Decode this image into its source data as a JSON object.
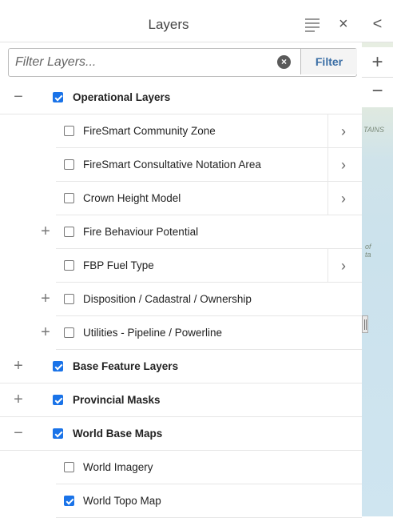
{
  "panel": {
    "title": "Layers",
    "list_icon": "list-icon",
    "close_label": "×"
  },
  "filter": {
    "placeholder": "Filter Layers...",
    "clear_label": "×",
    "button_label": "Filter"
  },
  "layers": [
    {
      "label": "Operational Layers",
      "checked": true,
      "bold": true,
      "expander": "−",
      "level": 0,
      "chevron": false
    },
    {
      "label": "FireSmart Community Zone",
      "checked": false,
      "bold": false,
      "expander": "",
      "level": 1,
      "chevron": true
    },
    {
      "label": "FireSmart Consultative Notation Area",
      "checked": false,
      "bold": false,
      "expander": "",
      "level": 1,
      "chevron": true
    },
    {
      "label": "Crown Height Model",
      "checked": false,
      "bold": false,
      "expander": "",
      "level": 1,
      "chevron": true
    },
    {
      "label": "Fire Behaviour Potential",
      "checked": false,
      "bold": false,
      "expander": "+",
      "level": 1,
      "chevron": false
    },
    {
      "label": "FBP Fuel Type",
      "checked": false,
      "bold": false,
      "expander": "",
      "level": 1,
      "chevron": true
    },
    {
      "label": "Disposition / Cadastral / Ownership",
      "checked": false,
      "bold": false,
      "expander": "+",
      "level": 1,
      "chevron": false
    },
    {
      "label": "Utilities - Pipeline / Powerline",
      "checked": false,
      "bold": false,
      "expander": "+",
      "level": 1,
      "chevron": false
    },
    {
      "label": "Base Feature Layers",
      "checked": true,
      "bold": true,
      "expander": "+",
      "level": 0,
      "chevron": false
    },
    {
      "label": "Provincial Masks",
      "checked": true,
      "bold": true,
      "expander": "+",
      "level": 0,
      "chevron": false
    },
    {
      "label": "World Base Maps",
      "checked": true,
      "bold": true,
      "expander": "−",
      "level": 0,
      "chevron": false
    },
    {
      "label": "World Imagery",
      "checked": false,
      "bold": false,
      "expander": "",
      "level": 1,
      "chevron": false
    },
    {
      "label": "World Topo Map",
      "checked": true,
      "bold": false,
      "expander": "",
      "level": 1,
      "chevron": false
    }
  ],
  "map": {
    "collapse_label": "<",
    "zoom_in_label": "+",
    "zoom_out_label": "−",
    "label_tains": "TAINS",
    "label_of": "of",
    "label_ta": "ta"
  },
  "colors": {
    "checkbox_checked": "#1a73e8",
    "filter_button_text": "#3a6ea5"
  }
}
